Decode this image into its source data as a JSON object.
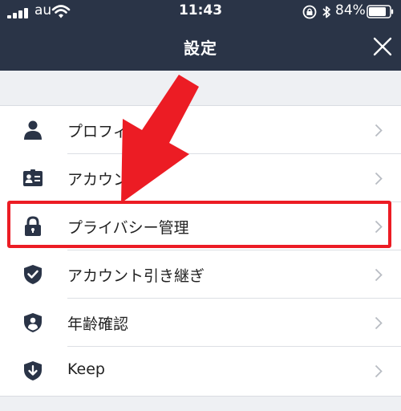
{
  "status_bar": {
    "carrier": "au",
    "time": "11:43",
    "battery": "84%"
  },
  "nav": {
    "title": "設定"
  },
  "settings": {
    "items": [
      {
        "label": "プロフィール",
        "icon": "person-icon"
      },
      {
        "label": "アカウント",
        "icon": "id-card-icon"
      },
      {
        "label": "プライバシー管理",
        "icon": "lock-icon"
      },
      {
        "label": "アカウント引き継ぎ",
        "icon": "shield-check-icon"
      },
      {
        "label": "年齢確認",
        "icon": "shield-person-icon"
      },
      {
        "label": "Keep",
        "icon": "keep-download-icon"
      }
    ]
  },
  "annotation": {
    "color": "#ec1c24"
  }
}
